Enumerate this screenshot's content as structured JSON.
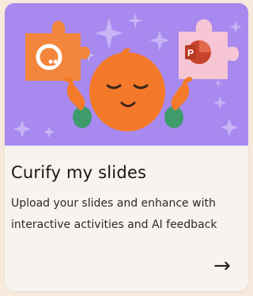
{
  "card": {
    "title": "Curify my slides",
    "description": "Upload your slides and enhance with interactive activities and AI feedback",
    "arrow_glyph": "→",
    "powerpoint_letter": "P"
  },
  "colors": {
    "hero_bg": "#a889ef",
    "card_bg": "#f8f3ee",
    "page_bg": "#f7e9dc",
    "mascot_orange": "#f47a2a",
    "puzzle_orange": "#f3863c",
    "puzzle_pink": "#f7c6d4",
    "powerpoint_red": "#c8432b"
  },
  "icons": [
    "sparkle-icon",
    "puzzle-piece-icon",
    "powerpoint-icon",
    "mascot-illustration",
    "arrow-right-icon"
  ]
}
